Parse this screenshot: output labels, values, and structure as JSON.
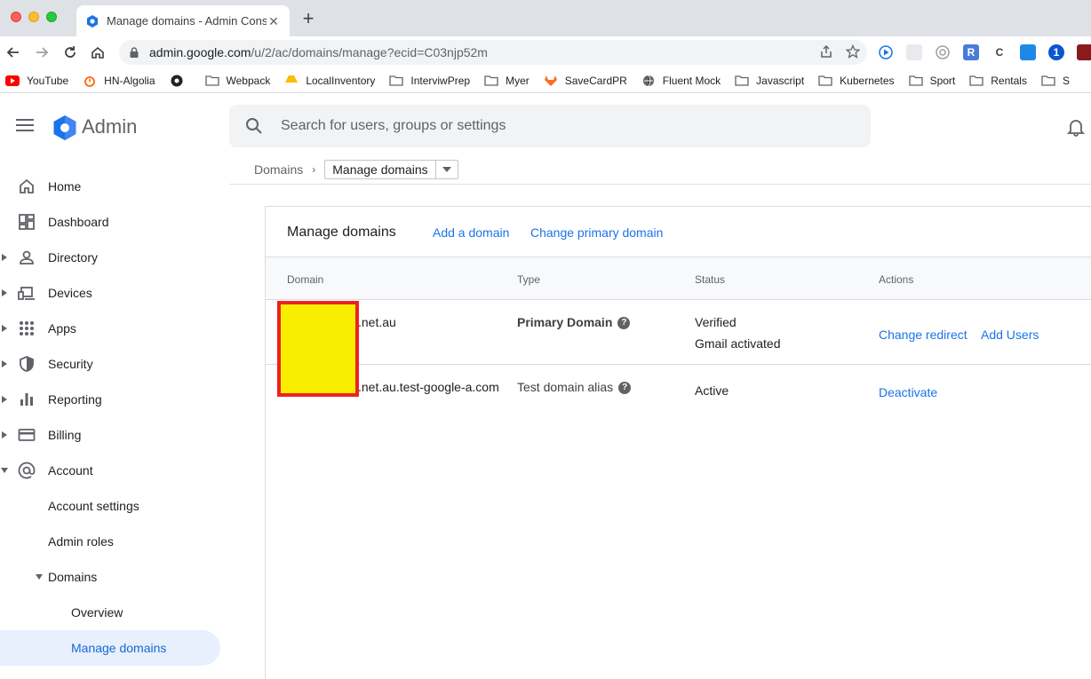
{
  "browser": {
    "tab_title": "Manage domains - Admin Cons",
    "url_host": "admin.google.com",
    "url_path": "/u/2/ac/domains/manage?ecid=C03njp52m",
    "bookmarks": [
      {
        "label": "YouTube",
        "icon": "youtube-icon"
      },
      {
        "label": "HN-Algolia",
        "icon": "algolia-icon"
      },
      {
        "label": "",
        "icon": "eye-icon"
      },
      {
        "label": "Webpack",
        "icon": "folder-icon"
      },
      {
        "label": "LocalInventory",
        "icon": "drive-icon"
      },
      {
        "label": "InterviwPrep",
        "icon": "folder-icon"
      },
      {
        "label": "Myer",
        "icon": "folder-icon"
      },
      {
        "label": "SaveCardPR",
        "icon": "gitlab-icon"
      },
      {
        "label": "Fluent Mock",
        "icon": "globe-icon"
      },
      {
        "label": "Javascript",
        "icon": "folder-icon"
      },
      {
        "label": "Kubernetes",
        "icon": "folder-icon"
      },
      {
        "label": "Sport",
        "icon": "folder-icon"
      },
      {
        "label": "Rentals",
        "icon": "folder-icon"
      },
      {
        "label": "S",
        "icon": "folder-icon"
      }
    ]
  },
  "header": {
    "app_title": "Admin",
    "search_placeholder": "Search for users, groups or settings"
  },
  "sidebar": {
    "items": [
      {
        "label": "Home",
        "icon": "home-icon"
      },
      {
        "label": "Dashboard",
        "icon": "dashboard-icon"
      },
      {
        "label": "Directory",
        "icon": "person-icon"
      },
      {
        "label": "Devices",
        "icon": "devices-icon"
      },
      {
        "label": "Apps",
        "icon": "apps-grid-icon"
      },
      {
        "label": "Security",
        "icon": "shield-icon"
      },
      {
        "label": "Reporting",
        "icon": "bar-chart-icon"
      },
      {
        "label": "Billing",
        "icon": "credit-card-icon"
      },
      {
        "label": "Account",
        "icon": "at-sign-icon"
      }
    ],
    "account_sub": {
      "account_settings": "Account settings",
      "admin_roles": "Admin roles",
      "domains": "Domains",
      "overview": "Overview",
      "manage_domains": "Manage domains"
    }
  },
  "breadcrumb": {
    "parent": "Domains",
    "current": "Manage domains"
  },
  "card": {
    "title": "Manage domains",
    "add_domain": "Add a domain",
    "change_primary": "Change primary domain",
    "columns": {
      "domain": "Domain",
      "type": "Type",
      "status": "Status",
      "actions": "Actions"
    },
    "rows": [
      {
        "domain": ".net.au",
        "type": "Primary Domain",
        "status_1": "Verified",
        "status_2": "Gmail activated",
        "action_1": "Change redirect",
        "action_2": "Add Users"
      },
      {
        "domain": ".net.au.test-google-a.com",
        "type": "Test domain alias",
        "status_1": "Active",
        "action_1": "Deactivate"
      }
    ]
  },
  "colors": {
    "accent": "#1a73e8",
    "active_bg": "#e8f0fe",
    "redaction_fill": "#f7ee00",
    "redaction_border": "#ee2222"
  }
}
